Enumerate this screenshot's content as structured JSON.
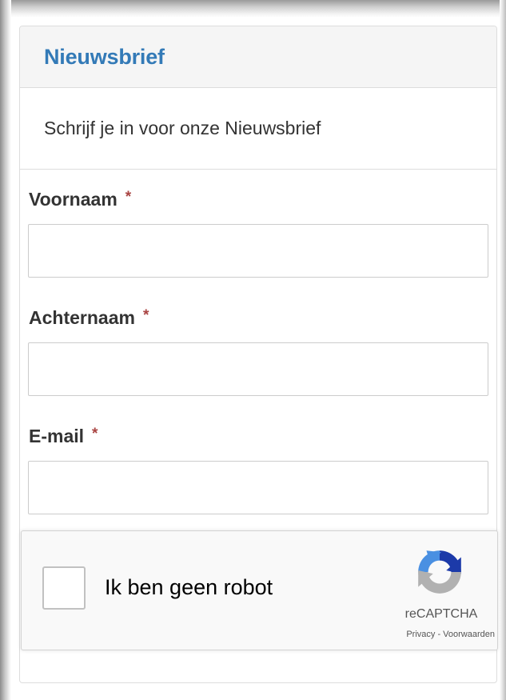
{
  "panel": {
    "title": "Nieuwsbrief",
    "intro": "Schrijf je in voor onze Nieuwsbrief"
  },
  "form": {
    "fields": [
      {
        "label": "Voornaam",
        "required_marker": "*",
        "value": "",
        "placeholder": ""
      },
      {
        "label": "Achternaam",
        "required_marker": "*",
        "value": "",
        "placeholder": ""
      },
      {
        "label": "E-mail",
        "required_marker": "*",
        "value": "",
        "placeholder": ""
      }
    ]
  },
  "recaptcha": {
    "checkbox_label": "Ik ben geen robot",
    "brand": "reCAPTCHA",
    "privacy_link": "Privacy",
    "separator": " - ",
    "terms_link": "Voorwaarden",
    "logo_icon": "recaptcha-logo-icon",
    "colors": {
      "blue": "#1c3aa9",
      "light_blue": "#4a90e2",
      "gray": "#b1b1b1"
    }
  },
  "colors": {
    "title": "#337ab7",
    "required": "#a94442",
    "text": "#333333",
    "heading_bg": "#f5f5f5",
    "border": "#dddddd"
  }
}
